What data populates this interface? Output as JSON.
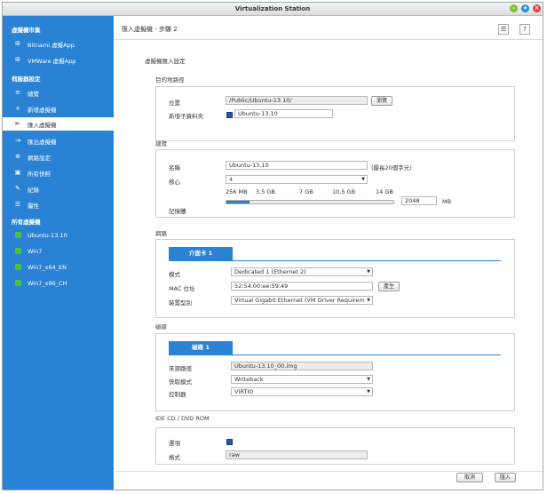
{
  "window": {
    "title": "Virtualization Station"
  },
  "sidebar": {
    "section1": "虛擬機市集",
    "market": [
      {
        "label": "Bitnami 虛擬App"
      },
      {
        "label": "VMWare 虛擬App"
      }
    ],
    "section2": "伺服器設定",
    "settings": [
      {
        "label": "總覽",
        "icon": "≡"
      },
      {
        "label": "新增虛擬機",
        "icon": "+"
      },
      {
        "label": "匯入虛擬機",
        "icon": "⇤"
      },
      {
        "label": "匯出虛擬機",
        "icon": "⇥"
      },
      {
        "label": "網路設定",
        "icon": "⊕"
      },
      {
        "label": "所有快照",
        "icon": "▣"
      },
      {
        "label": "紀錄",
        "icon": "✎"
      },
      {
        "label": "屬性",
        "icon": "☰"
      }
    ],
    "section3": "所有虛擬機",
    "vms": [
      {
        "label": "Ubuntu-13.10"
      },
      {
        "label": "Win7"
      },
      {
        "label": "Win7_x64_EN"
      },
      {
        "label": "Win7_x86_CH"
      }
    ]
  },
  "page": {
    "title": "匯入虛擬機 - 步驟 2",
    "subtitle": "虛擬機匯入設定"
  },
  "target": {
    "section": "目的地路徑",
    "location_label": "位置",
    "location_value": "/Public/Ubuntu-13.10/",
    "browse_label": "瀏覽",
    "new_folder_label": "新增子資料夾",
    "new_folder_value": "Ubuntu-13.10"
  },
  "overview": {
    "section": "總覽",
    "name_label": "名稱",
    "name_value": "Ubuntu-13.10",
    "name_hint": "(最長20個字元)",
    "cores_label": "核心",
    "cores_value": "4",
    "memory_label": "記憶體",
    "memory_ticks": [
      "256 MB",
      "3.5 GB",
      "7 GB",
      "10.5 GB",
      "14 GB"
    ],
    "memory_value": "2048",
    "memory_unit": "MB",
    "memory_fraction": 0.14
  },
  "network": {
    "section": "網路",
    "tab": "介面卡 1",
    "mode_label": "模式",
    "mode_value": "Dedicated 1 (Ethernet 2)",
    "mac_label": "MAC 位址",
    "mac_value": "52:54:00:ee:59:49",
    "mac_button": "產生",
    "model_label": "裝置型別",
    "model_value": "Virtual Gigabit Ethernet (VM Driver Requirem"
  },
  "disk": {
    "section": "磁碟",
    "tab": "磁碟 1",
    "source_label": "來源路徑",
    "source_value": "Ubuntu-13.10_00.img",
    "cache_label": "快取模式",
    "cache_value": "Writeback",
    "controller_label": "控制器",
    "controller_value": "VIRTIO"
  },
  "cdrom": {
    "section": "IDE CD / DVD ROM",
    "option_label": "選項",
    "format_label": "格式",
    "format_value": "raw"
  },
  "footer": {
    "cancel": "取消",
    "import": "匯入"
  }
}
